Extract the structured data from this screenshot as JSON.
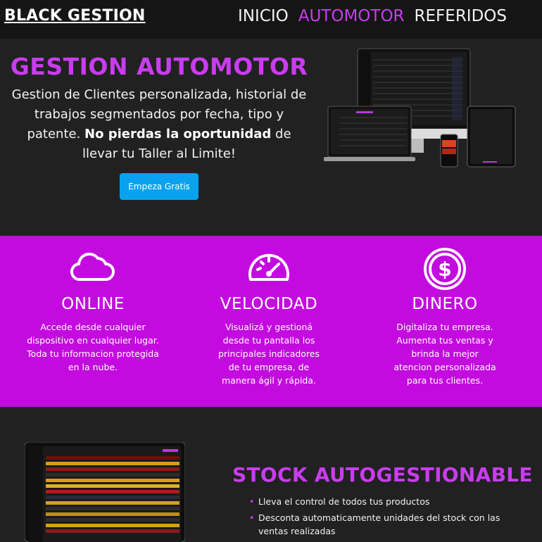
{
  "colors": {
    "accent": "#c93cf0",
    "band": "#c30bdf",
    "cta": "#0aa2ef",
    "background": "#212121",
    "nav_bg": "#151515"
  },
  "nav": {
    "brand": "BLACK GESTION",
    "items": [
      {
        "label": "INICIO",
        "active": false
      },
      {
        "label": "AUTOMOTOR",
        "active": true
      },
      {
        "label": "REFERIDOS",
        "active": false
      }
    ]
  },
  "hero": {
    "title": "GESTION AUTOMOTOR",
    "text_part1": "Gestion de Clientes personalizada, historial de trabajos segmentados por fecha, tipo y patente.",
    "text_bold": "No pierdas la oportunidad",
    "text_part2": "de llevar tu Taller al Limite!",
    "cta_label": "Empeza Gratis"
  },
  "features": [
    {
      "icon": "cloud-icon",
      "title": "ONLINE",
      "text": "Accede desde cualquier dispositivo en cualquier lugar. Toda tu informacion protegida en la nube."
    },
    {
      "icon": "speedometer-icon",
      "title": "VELOCIDAD",
      "text": "Visualizá y gestioná desde tu pantalla los principales indicadores de tu empresa, de manera ágil y rápida."
    },
    {
      "icon": "dollar-coin-icon",
      "title": "DINERO",
      "text": "Digitaliza tu empresa. Aumenta tus ventas y brinda la mejor atencion personalizada para tus clientes."
    }
  ],
  "stock": {
    "title": "STOCK AUTOGESTIONABLE",
    "bullet": "•",
    "items": [
      "Lleva el control de todos tus productos",
      "Desconta automaticamente unidades del stock con las ventas realizadas"
    ]
  }
}
